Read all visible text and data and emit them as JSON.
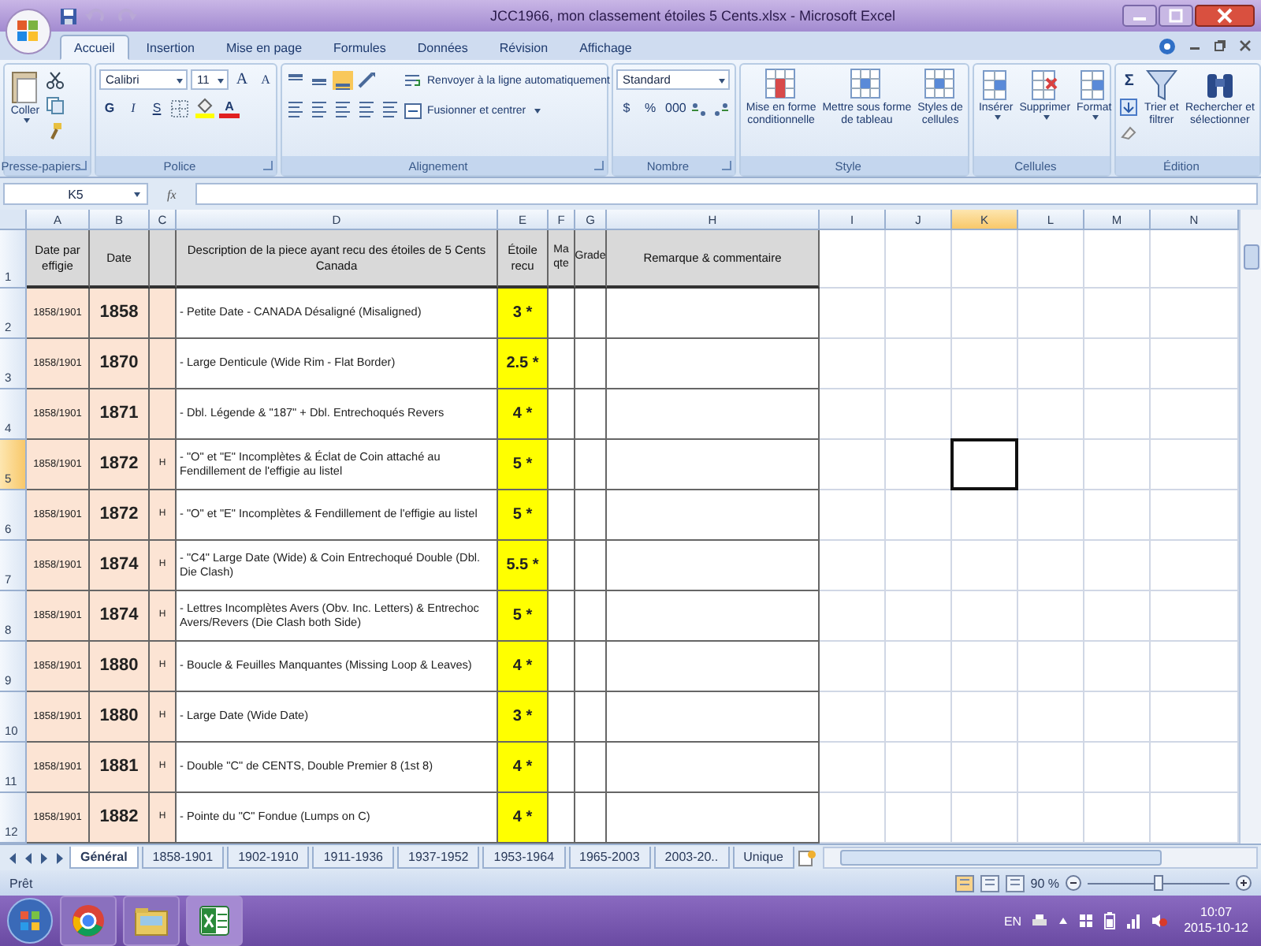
{
  "window": {
    "title": "JCC1966, mon classement étoiles 5 Cents.xlsx - Microsoft Excel"
  },
  "ribbon": {
    "tabs": [
      {
        "label": "Accueil",
        "selected": true
      },
      {
        "label": "Insertion",
        "selected": false
      },
      {
        "label": "Mise en page",
        "selected": false
      },
      {
        "label": "Formules",
        "selected": false
      },
      {
        "label": "Données",
        "selected": false
      },
      {
        "label": "Révision",
        "selected": false
      },
      {
        "label": "Affichage",
        "selected": false
      }
    ],
    "clipboard": {
      "label": "Presse-papiers",
      "paste": "Coller"
    },
    "font": {
      "label": "Police",
      "name": "Calibri",
      "size": "11",
      "grow": "A",
      "shrink": "A",
      "bold": "G",
      "italic": "I",
      "underline": "S",
      "foreground": "A"
    },
    "alignment": {
      "label": "Alignement",
      "wrap": "Renvoyer à la ligne automatiquement",
      "merge": "Fusionner et centrer"
    },
    "number": {
      "label": "Nombre",
      "format": "Standard",
      "currency": "$",
      "percent": "%",
      "thousands": "000"
    },
    "style": {
      "label": "Style",
      "buttons": [
        {
          "lines": [
            "Mise en forme",
            "conditionnelle"
          ]
        },
        {
          "lines": [
            "Mettre sous forme",
            "de tableau"
          ]
        },
        {
          "lines": [
            "Styles de",
            "cellules"
          ]
        }
      ]
    },
    "cells": {
      "label": "Cellules",
      "buttons": [
        {
          "lines": [
            "Insérer"
          ]
        },
        {
          "lines": [
            "Supprimer"
          ]
        },
        {
          "lines": [
            "Format"
          ]
        }
      ]
    },
    "editing": {
      "label": "Édition",
      "sum": "Σ",
      "buttons": [
        {
          "lines": [
            "Trier et",
            "filtrer"
          ]
        },
        {
          "lines": [
            "Rechercher et",
            "sélectionner"
          ]
        }
      ]
    }
  },
  "formula_bar": {
    "name_box": "K5",
    "fx": "fx"
  },
  "sheet": {
    "columns": [
      {
        "letter": "A",
        "selected": false
      },
      {
        "letter": "B",
        "selected": false
      },
      {
        "letter": "C",
        "selected": false
      },
      {
        "letter": "D",
        "selected": false
      },
      {
        "letter": "E",
        "selected": false
      },
      {
        "letter": "F",
        "selected": false
      },
      {
        "letter": "G",
        "selected": false
      },
      {
        "letter": "H",
        "selected": false
      },
      {
        "letter": "I",
        "selected": false
      },
      {
        "letter": "J",
        "selected": false
      },
      {
        "letter": "K",
        "selected": true
      },
      {
        "letter": "L",
        "selected": false
      },
      {
        "letter": "M",
        "selected": false
      },
      {
        "letter": "N",
        "selected": false
      }
    ],
    "header": {
      "row": "1",
      "effigy": "Date par effigie",
      "date": "Date",
      "description": "Description de la piece ayant recu des étoiles de 5 Cents Canada",
      "etoile": "Étoile recu",
      "quantity": "Ma qte",
      "grade": "Grade",
      "remark": "Remarque & commentaire"
    },
    "rows": [
      {
        "row": "2",
        "selected": false,
        "effigy": "1858/1901",
        "date": "1858",
        "description": "- Petite Date - CANADA Désaligné (Misaligned)",
        "etoile": "3 *"
      },
      {
        "row": "3",
        "selected": false,
        "effigy": "1858/1901",
        "date": "1870",
        "description": "- Large Denticule (Wide Rim - Flat Border)",
        "etoile": "2.5 *"
      },
      {
        "row": "4",
        "selected": false,
        "effigy": "1858/1901",
        "date": "1871",
        "description": "- Dbl. Légende & \"187\" + Dbl. Entrechoqués Revers",
        "etoile": "4 *"
      },
      {
        "row": "5",
        "selected": true,
        "effigy": "1858/1901",
        "date": "1872",
        "mark": "H",
        "description": "- \"O\" et \"E\" Incomplètes & Éclat de Coin attaché au Fendillement de l'effigie au listel",
        "etoile": "5 *"
      },
      {
        "row": "6",
        "selected": false,
        "effigy": "1858/1901",
        "date": "1872",
        "mark": "H",
        "description": "- \"O\" et \"E\" Incomplètes & Fendillement de l'effigie au listel",
        "etoile": "5 *"
      },
      {
        "row": "7",
        "selected": false,
        "effigy": "1858/1901",
        "date": "1874",
        "mark": "H",
        "description": "- \"C4\" Large Date (Wide) & Coin Entrechoqué Double (Dbl. Die Clash)",
        "etoile": "5.5 *"
      },
      {
        "row": "8",
        "selected": false,
        "effigy": "1858/1901",
        "date": "1874",
        "mark": "H",
        "description": "- Lettres Incomplètes Avers (Obv. Inc. Letters) & Entrechoc Avers/Revers (Die Clash both Side)",
        "etoile": "5 *"
      },
      {
        "row": "9",
        "selected": false,
        "effigy": "1858/1901",
        "date": "1880",
        "mark": "H",
        "description": "- Boucle & Feuilles Manquantes (Missing Loop & Leaves)",
        "etoile": "4 *"
      },
      {
        "row": "10",
        "selected": false,
        "effigy": "1858/1901",
        "date": "1880",
        "mark": "H",
        "description": "- Large Date (Wide Date)",
        "etoile": "3 *"
      },
      {
        "row": "11",
        "selected": false,
        "effigy": "1858/1901",
        "date": "1881",
        "mark": "H",
        "description": "- Double \"C\" de CENTS, Double Premier 8 (1st 8)",
        "etoile": "4 *"
      },
      {
        "row": "12",
        "selected": false,
        "effigy": "1858/1901",
        "date": "1882",
        "mark": "H",
        "description": "- Pointe du \"C\" Fondue (Lumps on C)",
        "etoile": "4 *"
      }
    ]
  },
  "sheet_tabs": [
    {
      "label": "Général",
      "selected": true
    },
    {
      "label": "1858-1901",
      "selected": false
    },
    {
      "label": "1902-1910",
      "selected": false
    },
    {
      "label": "1911-1936",
      "selected": false
    },
    {
      "label": "1937-1952",
      "selected": false
    },
    {
      "label": "1953-1964",
      "selected": false
    },
    {
      "label": "1965-2003",
      "selected": false
    },
    {
      "label": "2003-20..",
      "selected": false
    },
    {
      "label": "Unique",
      "selected": false
    }
  ],
  "status_bar": {
    "text": "Prêt",
    "zoom": "90 %",
    "level": 0.5
  },
  "taskbar": {
    "language": "EN",
    "time": "10:07",
    "date": "2015-10-12"
  }
}
